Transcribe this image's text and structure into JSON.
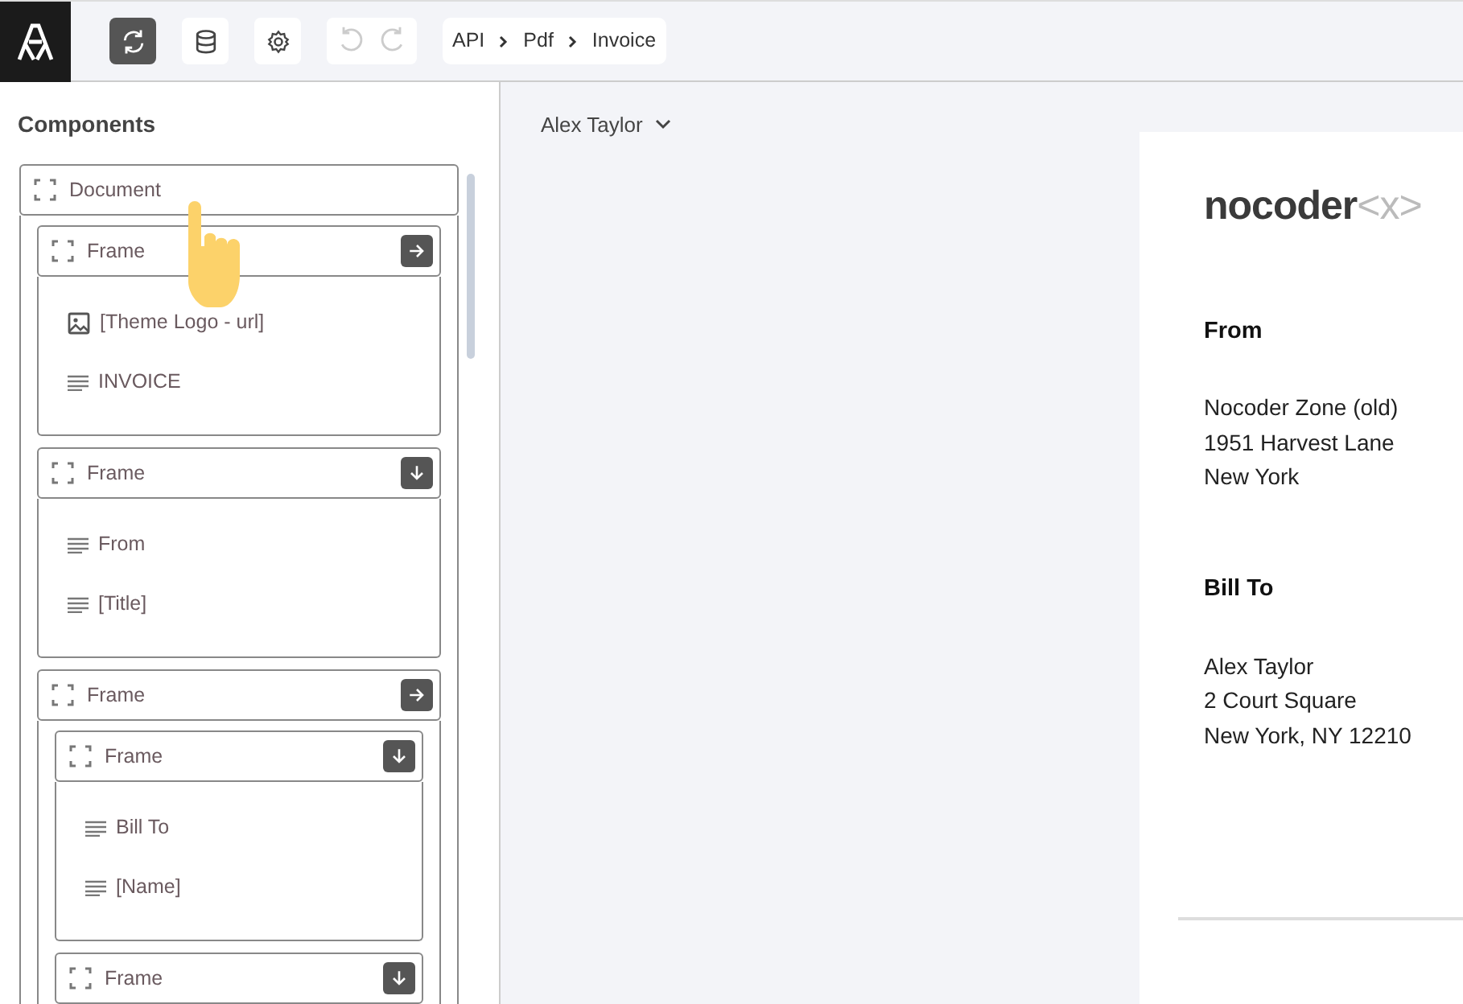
{
  "toolbar": {
    "buttons": [
      {
        "kind": "sync",
        "selected": true
      },
      {
        "kind": "database",
        "selected": false
      },
      {
        "kind": "settings",
        "selected": false
      }
    ],
    "history": [
      {
        "kind": "undo",
        "disabled": true
      },
      {
        "kind": "redo",
        "disabled": true
      }
    ],
    "breadcrumb": [
      "API",
      "Pdf",
      "Invoice"
    ]
  },
  "sidebar": {
    "title": "Components",
    "tree": [
      {
        "kind": "frame",
        "label": "Document",
        "children": [
          {
            "kind": "frame",
            "label": "Frame",
            "horizontal": true,
            "children": [
              {
                "kind": "image",
                "label": "[Theme Logo - url]"
              },
              {
                "kind": "text",
                "label": "INVOICE"
              }
            ]
          },
          {
            "kind": "frame",
            "label": "Frame",
            "horizontal": false,
            "children": [
              {
                "kind": "text",
                "label": "From"
              },
              {
                "kind": "text",
                "label": "[Title]"
              }
            ]
          },
          {
            "kind": "frame",
            "label": "Frame",
            "horizontal": true,
            "children": [
              {
                "kind": "frame",
                "label": "Frame",
                "horizontal": false,
                "children": [
                  {
                    "kind": "text",
                    "label": "Bill To"
                  },
                  {
                    "kind": "text",
                    "label": "[Name]"
                  }
                ]
              },
              {
                "kind": "frame",
                "label": "Frame",
                "horizontal": false
              }
            ]
          }
        ]
      }
    ]
  },
  "preview": {
    "user": "Alex Taylor",
    "logo": {
      "name": "nocoder",
      "mark": "<x>"
    },
    "sections": [
      {
        "heading": "From",
        "lines": [
          "Nocoder Zone (old)",
          "1951 Harvest Lane",
          "New York"
        ]
      },
      {
        "heading": "Bill To",
        "lines": [
          "Alex Taylor",
          "2 Court Square",
          "New York, NY 12210"
        ]
      }
    ]
  }
}
